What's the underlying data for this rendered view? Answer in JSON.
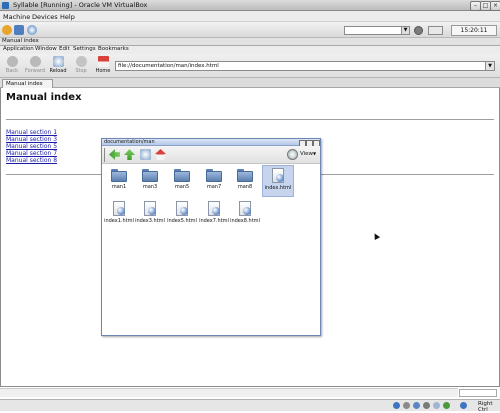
{
  "vbox": {
    "title": "Syllable [Running] - Oracle VM VirtualBox",
    "menu": [
      "Machine",
      "Devices",
      "Help"
    ],
    "right_ctrl": "Right Ctrl"
  },
  "desktop_panel": {
    "clock": "15:20:11"
  },
  "browser": {
    "window_title": "Manual index",
    "menu": [
      "Application",
      "Window",
      "Edit",
      "Settings",
      "Bookmarks"
    ],
    "toolbar": {
      "back": "Back",
      "forward": "Forward",
      "reload": "Reload",
      "stop": "Stop",
      "home": "Home"
    },
    "url": "file://documentation/man/index.html",
    "tab_label": "Manual index",
    "page": {
      "title": "Manual index",
      "links": [
        "Manual section 1",
        "Manual section 3",
        "Manual section 5",
        "Manual section 7",
        "Manual section 8"
      ]
    }
  },
  "file_manager": {
    "title": "documentation/man",
    "view_label": "View",
    "folders": [
      "man1",
      "man3",
      "man5",
      "man7",
      "man8"
    ],
    "files": [
      "index.html",
      "index1.html",
      "index3.html",
      "index5.html",
      "index7.html",
      "index8.html"
    ],
    "selected": "index.html"
  },
  "colors": {
    "link": "#1a1aa8",
    "folder": "#5d80b2",
    "selection": "#c6d4ee",
    "fm_border": "#6e86b6"
  }
}
